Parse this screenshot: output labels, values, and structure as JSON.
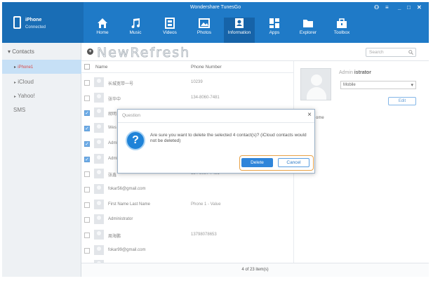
{
  "app": {
    "title": "Wondershare TunesGo",
    "device_name": "iPhone",
    "device_status": "Connected"
  },
  "window_controls": [
    "person-icon",
    "menu-icon",
    "minimize-icon",
    "maximize-icon",
    "close-icon"
  ],
  "nav": [
    {
      "label": "Home",
      "icon": "home-icon"
    },
    {
      "label": "Music",
      "icon": "music-icon"
    },
    {
      "label": "Videos",
      "icon": "video-icon"
    },
    {
      "label": "Photos",
      "icon": "photo-icon"
    },
    {
      "label": "Information",
      "icon": "contacts-icon",
      "active": true
    },
    {
      "label": "Apps",
      "icon": "apps-icon"
    },
    {
      "label": "Explorer",
      "icon": "folder-icon"
    },
    {
      "label": "Toolbox",
      "icon": "toolbox-icon"
    }
  ],
  "sidebar": {
    "contacts_label": "Contacts",
    "items": [
      {
        "label": "iPhone1",
        "selected": true
      },
      {
        "label": "iCloud"
      },
      {
        "label": "Yahoo!"
      }
    ],
    "sms_label": "SMS"
  },
  "toolbar": {
    "new_label": "New",
    "refresh_label": "Refresh",
    "search_placeholder": "Search"
  },
  "list": {
    "col_name": "Name",
    "col_phone": "Phone Number",
    "rows": [
      {
        "name": "长城宽带一号",
        "phone": "10239",
        "checked": false
      },
      {
        "name": "张华中",
        "phone": "134-8060-7481",
        "checked": false
      },
      {
        "name": "胡明",
        "phone": "",
        "checked": true
      },
      {
        "name": "Wes",
        "phone": "",
        "checked": true
      },
      {
        "name": "Admin",
        "phone": "",
        "checked": true
      },
      {
        "name": "Admin",
        "phone": "",
        "checked": true
      },
      {
        "name": "张鑫",
        "phone": "134-8087-7481",
        "checked": false
      },
      {
        "name": "fokar56@gmail.com",
        "phone": "",
        "checked": false
      },
      {
        "name": "First Name Last Name",
        "phone": "Phone 1 - Value",
        "checked": false
      },
      {
        "name": "Administrator",
        "phone": "",
        "checked": false
      },
      {
        "name": "周海鹏",
        "phone": "13798078653",
        "checked": false
      },
      {
        "name": "fokar99@gmail.com",
        "phone": "",
        "checked": false
      },
      {
        "name": "",
        "phone": "",
        "checked": false
      }
    ],
    "footer": "4 of 23 item(s)"
  },
  "detail": {
    "name_prefix": "Admin",
    "name_rest": "istrator",
    "select_value": "Mobile",
    "edit_label": "Edit",
    "fragment": "ome"
  },
  "dialog": {
    "title": "Question",
    "message": "Are sure you want to delete the selected 4 contact(s)? (iCloud contacts would not be deleted)",
    "delete_label": "Delete",
    "cancel_label": "Cancel",
    "close_glyph": "×",
    "icon_glyph": "?"
  }
}
